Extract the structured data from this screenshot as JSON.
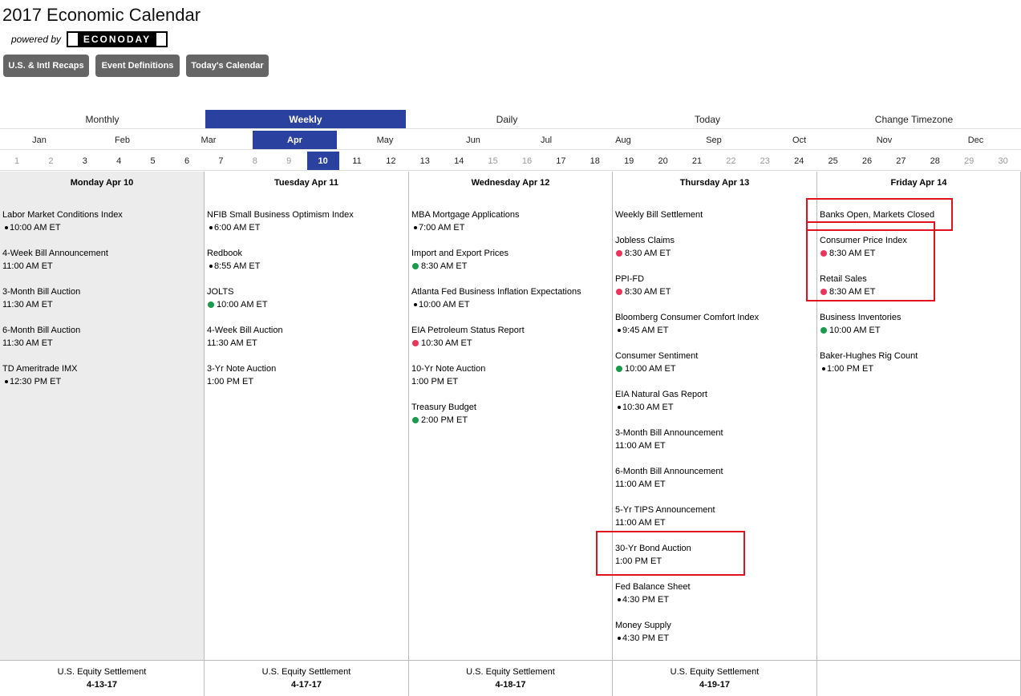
{
  "header": {
    "title": "2017 Economic Calendar",
    "powered_by": "powered by",
    "logo_text": "ECONODAY"
  },
  "buttons": [
    {
      "label": "U.S. & Intl Recaps"
    },
    {
      "label": "Event Definitions"
    },
    {
      "label": "Today's Calendar"
    }
  ],
  "views": [
    {
      "label": "Monthly",
      "active": false
    },
    {
      "label": "Weekly",
      "active": true
    },
    {
      "label": "Daily",
      "active": false
    },
    {
      "label": "Today",
      "active": false
    },
    {
      "label": "Change Timezone",
      "active": false
    }
  ],
  "months": [
    "Jan",
    "Feb",
    "Mar",
    "Apr",
    "May",
    "Jun",
    "Jul",
    "Aug",
    "Sep",
    "Oct",
    "Nov",
    "Dec"
  ],
  "active_month": "Apr",
  "days": [
    "1",
    "2",
    "3",
    "4",
    "5",
    "6",
    "7",
    "8",
    "9",
    "10",
    "11",
    "12",
    "13",
    "14",
    "15",
    "16",
    "17",
    "18",
    "19",
    "20",
    "21",
    "22",
    "23",
    "24",
    "25",
    "26",
    "27",
    "28",
    "29",
    "30"
  ],
  "active_day": "10",
  "weekend_days": [
    "1",
    "2",
    "8",
    "9",
    "15",
    "16",
    "22",
    "23",
    "29",
    "30"
  ],
  "columns": [
    {
      "heading": "Monday Apr 10",
      "events": [
        {
          "name": "Labor Market Conditions Index",
          "time": "10:00 AM ET",
          "dot": "black"
        },
        {
          "name": "4-Week Bill Announcement",
          "time": "11:00 AM ET",
          "dot": ""
        },
        {
          "name": "3-Month Bill Auction",
          "time": "11:30 AM ET",
          "dot": ""
        },
        {
          "name": "6-Month Bill Auction",
          "time": "11:30 AM ET",
          "dot": ""
        },
        {
          "name": "TD Ameritrade IMX",
          "time": "12:30 PM ET",
          "dot": "black"
        }
      ],
      "footer": {
        "label": "U.S. Equity Settlement",
        "date": "4-13-17"
      }
    },
    {
      "heading": "Tuesday Apr 11",
      "events": [
        {
          "name": "NFIB Small Business Optimism Index",
          "time": "6:00 AM ET",
          "dot": "black"
        },
        {
          "name": "Redbook",
          "time": "8:55 AM ET",
          "dot": "black"
        },
        {
          "name": "JOLTS",
          "time": "10:00 AM ET",
          "dot": "green"
        },
        {
          "name": "4-Week Bill Auction",
          "time": "11:30 AM ET",
          "dot": ""
        },
        {
          "name": "3-Yr Note Auction",
          "time": "1:00 PM ET",
          "dot": ""
        }
      ],
      "footer": {
        "label": "U.S. Equity Settlement",
        "date": "4-17-17"
      }
    },
    {
      "heading": "Wednesday Apr 12",
      "events": [
        {
          "name": "MBA Mortgage Applications",
          "time": "7:00 AM ET",
          "dot": "black"
        },
        {
          "name": "Import and Export Prices",
          "time": "8:30 AM ET",
          "dot": "green"
        },
        {
          "name": "Atlanta Fed Business Inflation Expectations",
          "time": "10:00 AM ET",
          "dot": "black"
        },
        {
          "name": "EIA Petroleum Status Report",
          "time": "10:30 AM ET",
          "dot": "red"
        },
        {
          "name": "10-Yr Note Auction",
          "time": "1:00 PM ET",
          "dot": ""
        },
        {
          "name": "Treasury Budget",
          "time": "2:00 PM ET",
          "dot": "green"
        }
      ],
      "footer": {
        "label": "U.S. Equity Settlement",
        "date": "4-18-17"
      }
    },
    {
      "heading": "Thursday Apr 13",
      "events": [
        {
          "name": "Weekly Bill Settlement",
          "time": "",
          "dot": ""
        },
        {
          "name": "Jobless Claims",
          "time": "8:30 AM ET",
          "dot": "red"
        },
        {
          "name": "PPI-FD",
          "time": "8:30 AM ET",
          "dot": "red"
        },
        {
          "name": "Bloomberg Consumer Comfort Index",
          "time": "9:45 AM ET",
          "dot": "black"
        },
        {
          "name": "Consumer Sentiment",
          "time": "10:00 AM ET",
          "dot": "green"
        },
        {
          "name": "EIA Natural Gas Report",
          "time": "10:30 AM ET",
          "dot": "black"
        },
        {
          "name": "3-Month Bill Announcement",
          "time": "11:00 AM ET",
          "dot": ""
        },
        {
          "name": "6-Month Bill Announcement",
          "time": "11:00 AM ET",
          "dot": ""
        },
        {
          "name": "5-Yr TIPS Announcement",
          "time": "11:00 AM ET",
          "dot": ""
        },
        {
          "name": "30-Yr Bond Auction",
          "time": "1:00 PM ET",
          "dot": ""
        },
        {
          "name": "Fed Balance Sheet",
          "time": "4:30 PM ET",
          "dot": "black"
        },
        {
          "name": "Money Supply",
          "time": "4:30 PM ET",
          "dot": "black"
        }
      ],
      "footer": {
        "label": "U.S. Equity Settlement",
        "date": "4-19-17"
      }
    },
    {
      "heading": "Friday Apr 14",
      "events": [
        {
          "name": "Banks Open, Markets Closed",
          "time": "",
          "dot": ""
        },
        {
          "name": "Consumer Price Index",
          "time": "8:30 AM ET",
          "dot": "red"
        },
        {
          "name": "Retail Sales",
          "time": "8:30 AM ET",
          "dot": "red"
        },
        {
          "name": "Business Inventories",
          "time": "10:00 AM ET",
          "dot": "green"
        },
        {
          "name": "Baker-Hughes Rig Count",
          "time": "1:00 PM ET",
          "dot": "black"
        }
      ],
      "footer": {
        "label": "",
        "date": ""
      }
    }
  ],
  "colors": {
    "active_tab": "#2b41a0",
    "button_bg": "#666666",
    "dot_green": "#1a9a4a",
    "dot_red": "#e8355a",
    "highlight": "#e0121e"
  }
}
